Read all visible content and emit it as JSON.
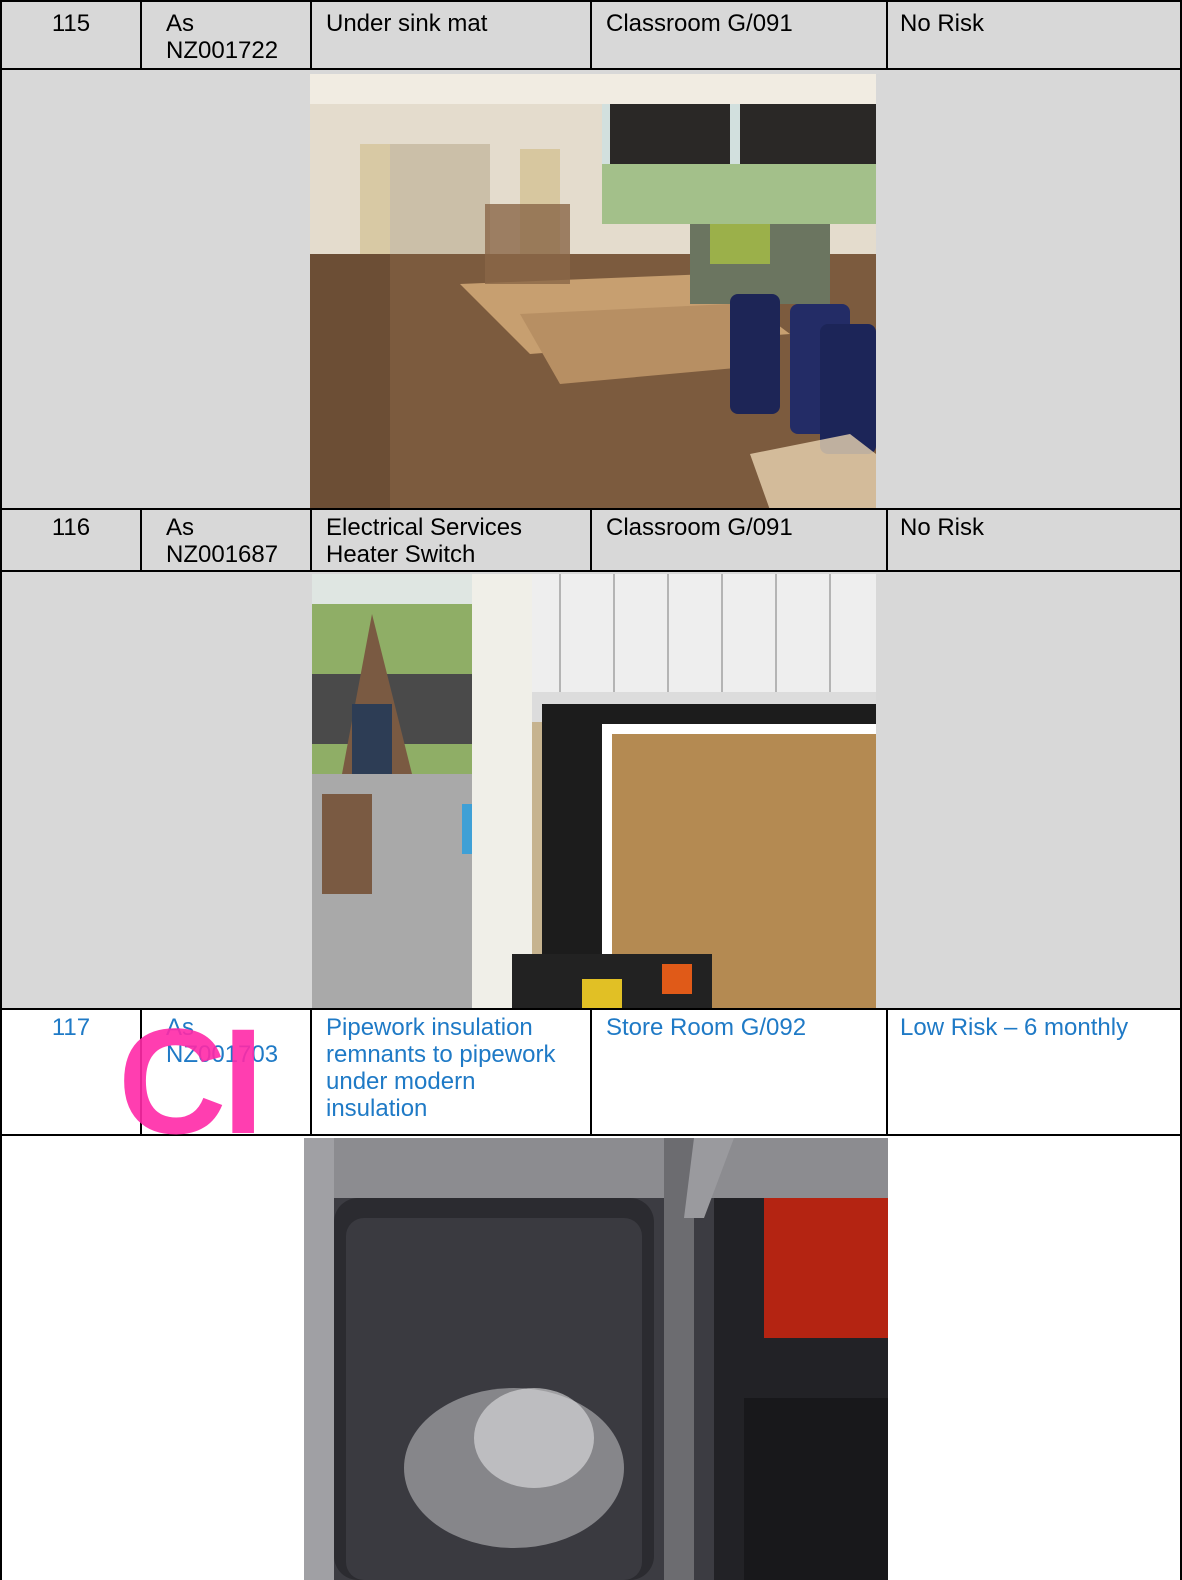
{
  "rows": [
    {
      "item": "115",
      "ref": "As NZ001722",
      "product": "Under sink mat",
      "location": "Classroom G/091",
      "risk": "No Risk"
    },
    {
      "item": "116",
      "ref": "As NZ001687",
      "product": "Electrical Services Heater Switch",
      "location": "Classroom G/091",
      "risk": "No Risk"
    },
    {
      "item": "117",
      "ref": "As NZ001703",
      "product": "Pipework insulation remnants to pipework under modern insulation",
      "location": "Store Room G/092",
      "risk": "Low Risk – 6 monthly"
    }
  ],
  "watermark": "CI",
  "photos": [
    {
      "name": "classroom-photo",
      "subject": "classroom with tables and blue chairs"
    },
    {
      "name": "window-heater-photo",
      "subject": "window, phonics chart and notice board"
    },
    {
      "name": "pipework-photo",
      "subject": "foil-wrapped pipework in cupboard"
    }
  ],
  "colors": {
    "header_bg": "#d8d8d8",
    "highlight_text": "#1f7ac6",
    "watermark": "#ff2aa8"
  }
}
